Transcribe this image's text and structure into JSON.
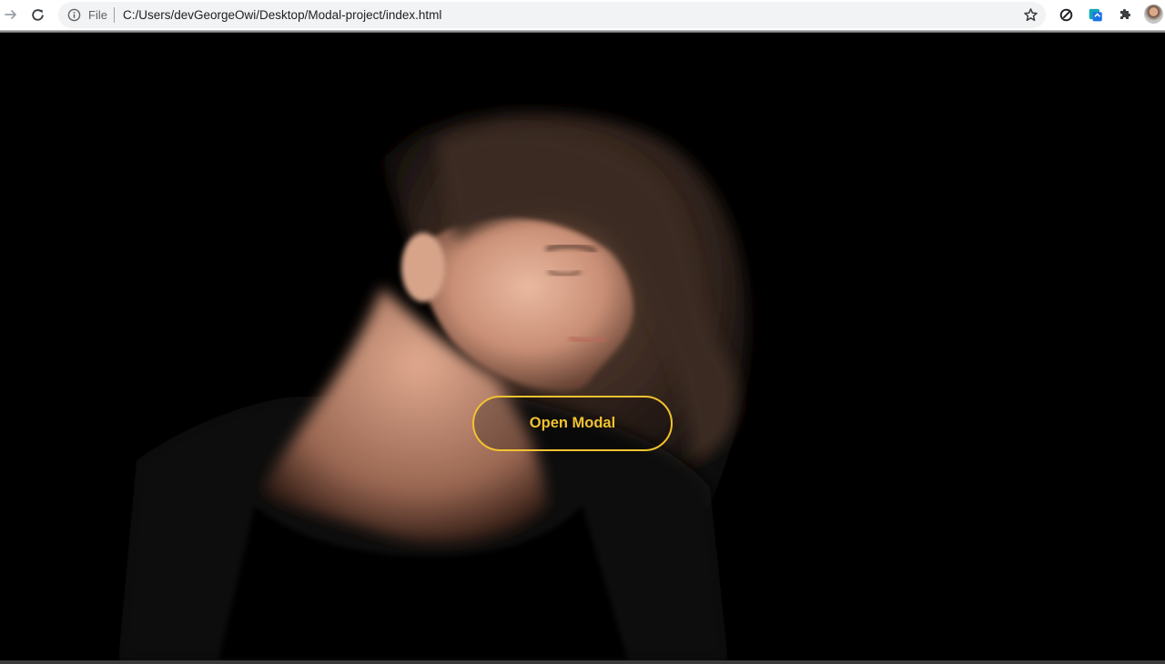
{
  "browser": {
    "file_label": "File",
    "url": "C:/Users/devGeorgeOwi/Desktop/Modal-project/index.html",
    "icons": {
      "back": "arrow-right-icon",
      "reload": "reload-icon",
      "info": "info-icon",
      "bookmark": "star-icon",
      "extension1": "sync-icon",
      "extension2": "screenshot-icon",
      "extensions": "puzzle-icon",
      "profile": "avatar"
    }
  },
  "page": {
    "open_modal_label": "Open Modal",
    "accent_color": "#f2c230",
    "background_color": "#000000"
  }
}
